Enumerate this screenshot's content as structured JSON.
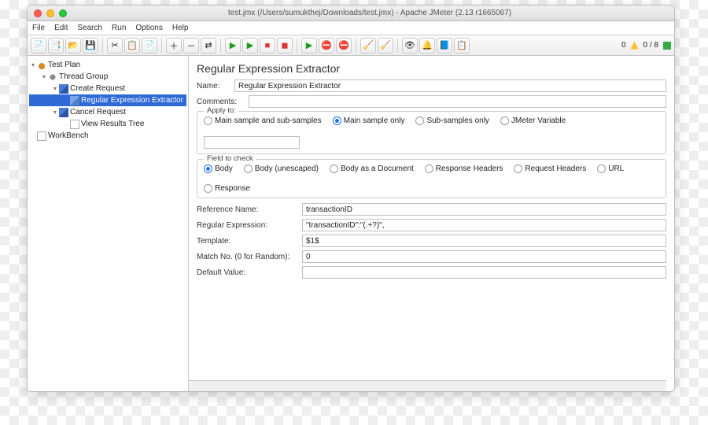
{
  "window": {
    "title": "test.jmx (/Users/sumukthej/Downloads/test.jmx) - Apache JMeter (2.13 r1665067)"
  },
  "menu": {
    "file": "File",
    "edit": "Edit",
    "search": "Search",
    "run": "Run",
    "options": "Options",
    "help": "Help"
  },
  "toolbar_right": {
    "zero": "0",
    "slash": "0 / 8"
  },
  "tree": {
    "testplan": "Test Plan",
    "threadgroup": "Thread Group",
    "create": "Create Request",
    "regex": "Regular Expression Extractor",
    "cancel": "Cancel Request",
    "results": "View Results Tree",
    "workbench": "WorkBench"
  },
  "panel": {
    "title": "Regular Expression Extractor",
    "name_label": "Name:",
    "name_value": "Regular Expression Extractor",
    "comments_label": "Comments:",
    "comments_value": "",
    "apply_label": "Apply to:",
    "apply": {
      "a": "Main sample and sub-samples",
      "b": "Main sample only",
      "c": "Sub-samples only",
      "d": "JMeter Variable"
    },
    "field_label": "Field to check",
    "field": {
      "a": "Body",
      "b": "Body (unescaped)",
      "c": "Body as a Document",
      "d": "Response Headers",
      "e": "Request Headers",
      "f": "URL",
      "g": "Response"
    },
    "ref_label": "Reference Name:",
    "ref_value": "transactionID",
    "regex_label": "Regular Expression:",
    "regex_value": "\"transactionID\":\"(.+?)\",",
    "tmpl_label": "Template:",
    "tmpl_value": "$1$",
    "match_label": "Match No. (0 for Random):",
    "match_value": "0",
    "default_label": "Default Value:",
    "default_value": ""
  }
}
